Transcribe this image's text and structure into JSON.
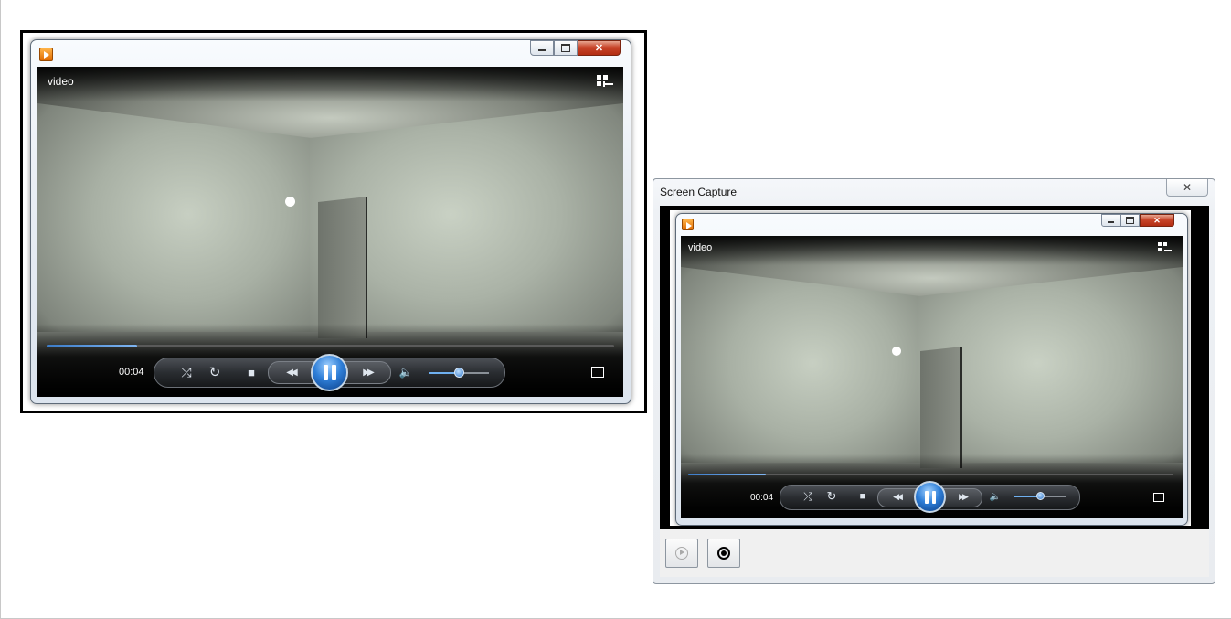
{
  "player": {
    "video_title": "video",
    "elapsed_time": "00:04",
    "seek_progress_percent": 16,
    "volume_percent": 50,
    "icons": {
      "app": "media-player-icon",
      "switch_view": "switch-to-library-icon",
      "shuffle": "shuffle-icon",
      "repeat": "repeat-icon",
      "stop": "stop-icon",
      "previous": "rewind-icon",
      "pause": "pause-icon",
      "next": "fast-forward-icon",
      "mute": "speaker-icon",
      "fullscreen": "fullscreen-icon"
    },
    "glyphs": {
      "shuffle": "⤮",
      "repeat": "↻",
      "stop": "■",
      "previous": "◀◀",
      "next": "▶▶",
      "mute": "🔈",
      "close": "✕"
    },
    "colors": {
      "accent": "#2f7fd8",
      "close_button": "#c8452a"
    }
  },
  "screen_capture": {
    "title": "Screen Capture",
    "close_glyph": "✕",
    "buttons": {
      "play": "play-icon",
      "record": "record-icon"
    },
    "preview": {
      "video_title": "video",
      "elapsed_time": "00:04"
    }
  }
}
